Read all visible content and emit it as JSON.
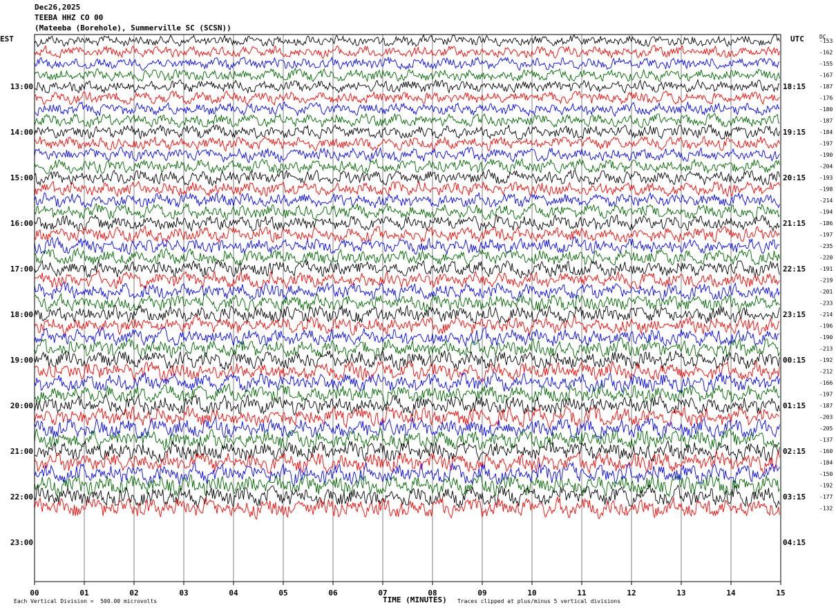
{
  "header": {
    "date": "Dec26,2025",
    "station": "TEEBA HHZ CO 00",
    "location": "(Mateeba (Borehole), Summerville SC (SCSN))"
  },
  "chart_data": {
    "type": "line",
    "title": "Dec26,2025",
    "subtitle": "TEEBA HHZ CO 00",
    "xlabel": "TIME (MINUTES)",
    "x_ticks": [
      "00",
      "01",
      "02",
      "03",
      "04",
      "05",
      "06",
      "07",
      "08",
      "09",
      "10",
      "11",
      "12",
      "13",
      "14",
      "15"
    ],
    "xlim": [
      0,
      15
    ],
    "left_axis_label": "EST",
    "right_axis_label": "UTC",
    "dc_label": "DC",
    "est_hours": [
      "13:00",
      "14:00",
      "15:00",
      "16:00",
      "17:00",
      "18:00",
      "19:00",
      "20:00",
      "21:00",
      "22:00",
      "23:00"
    ],
    "utc_hours": [
      "18:15",
      "19:15",
      "20:15",
      "21:15",
      "22:15",
      "23:15",
      "00:15",
      "01:15",
      "02:15",
      "03:15",
      "04:15"
    ],
    "trace_colors": [
      "#000000",
      "#ff0000",
      "#0000ff",
      "#006400"
    ],
    "dc_offsets": [
      "-153",
      "-162",
      "-155",
      "-167",
      "-187",
      "-176",
      "-180",
      "-187",
      "-184",
      "-197",
      "-190",
      "-204",
      "-193",
      "-198",
      "-214",
      "-194",
      "-186",
      "-197",
      "-235",
      "-220",
      "-191",
      "-219",
      "-201",
      "-233",
      "-214",
      "-196",
      "-190",
      "-213",
      "-192",
      "-212",
      "-166",
      "-197",
      "-187",
      "-203",
      "-205",
      "-137",
      "-160",
      "-184",
      "-150",
      "-192",
      "-177",
      "-132"
    ],
    "scale_note": "Each Vertical Division =  500.00 microvolts",
    "clip_note": "Traces clipped at plus/minus 5 vertical divisions",
    "grid": true
  }
}
